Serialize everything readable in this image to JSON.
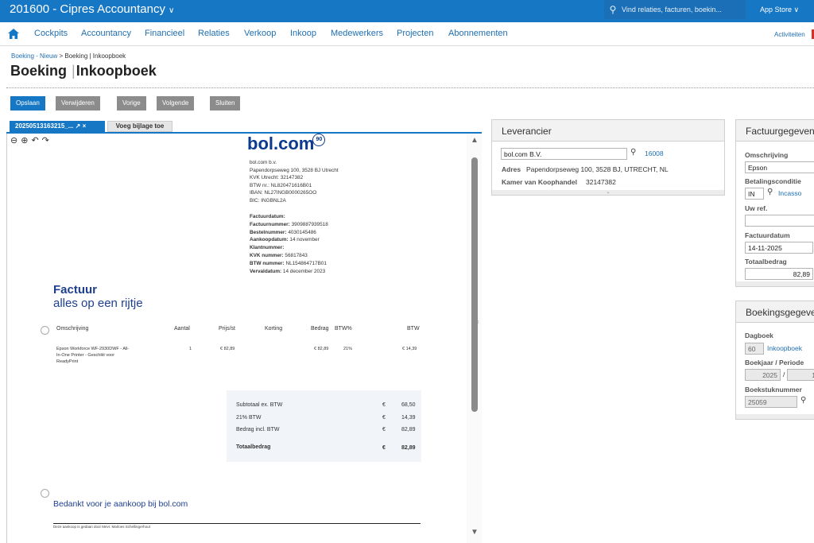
{
  "app": {
    "title": "201600 - Cipres Accountancy",
    "search_placeholder": "Vind relaties, facturen, boekin...",
    "app_store": "App Store"
  },
  "menu": {
    "items": [
      "Cockpits",
      "Accountancy",
      "Financieel",
      "Relaties",
      "Verkoop",
      "Inkoop",
      "Medewerkers",
      "Projecten",
      "Abonnementen"
    ],
    "activities": "Activiteiten"
  },
  "breadcrumb": {
    "link": "Boeking - Nieuw",
    "rest": " > Boeking | Inkoopboek"
  },
  "page": {
    "title_main": "Boeking",
    "title_sub": "Inkoopboek"
  },
  "toolbar": {
    "save": "Opslaan",
    "delete": "Verwijderen",
    "prev": "Vorige",
    "next": "Volgende",
    "close": "Sluiten"
  },
  "attachments": {
    "tab_label": "20250513163215_...",
    "add_label": "Voeg bijlage toe"
  },
  "invoice": {
    "logo": "bol.com",
    "logo_badge": "90",
    "address_lines": [
      "bol.com b.v.",
      "Papendorpseweg 100, 3528 BJ Utrecht",
      "KVK Utrecht: 32147382",
      "BTW nr.: NL820471616B01",
      "IBAN: NL27INGB0000265OO",
      "BIC: INGBNL2A"
    ],
    "meta": [
      {
        "k": "Factuurdatum:",
        "v": ""
      },
      {
        "k": "Factuurnummer:",
        "v": "3909887939518"
      },
      {
        "k": "Bestelnummer:",
        "v": "4030145486"
      },
      {
        "k": "Aankoopdatum:",
        "v": "14 november"
      },
      {
        "k": "Klantnummer:",
        "v": ""
      },
      {
        "k": "KVK nummer:",
        "v": "56817843"
      },
      {
        "k": "BTW nummer:",
        "v": "NL154864717B01"
      },
      {
        "k": "Vervaldatum:",
        "v": "14 december 2023"
      }
    ],
    "heading": "Factuur",
    "subheading": "alles op een rijtje",
    "columns": {
      "desc": "Omschrijving",
      "qty": "Aantal",
      "price": "Prijs/st",
      "discount": "Korting",
      "amount": "Bedrag",
      "vat_pct": "BTW%",
      "vat": "BTW"
    },
    "line": {
      "desc1": "Epson Workforce WF-2930DWF - All-",
      "desc2": "In-One Printer - Geschikt voor",
      "desc3": "ReadyPrint",
      "qty": "1",
      "price": "€ 82,89",
      "amount": "€ 82,89",
      "vat_pct": "21%",
      "vat": "€ 14,39"
    },
    "totals": {
      "sub_label": "Subtotaal ex. BTW",
      "sub_cur": "€",
      "sub_val": "68,50",
      "vat_label": "21% BTW",
      "vat_cur": "€",
      "vat_val": "14,39",
      "incl_label": "Bedrag incl. BTW",
      "incl_cur": "€",
      "incl_val": "82,89",
      "total_label": "Totaalbedrag",
      "total_cur": "€",
      "total_val": "82,89"
    },
    "thanks": "Bedankt voor je aankoop bij bol.com",
    "footer": "Deze aankoop is gedaan door Mevr. Marloes Schellingerhout"
  },
  "supplier": {
    "header": "Leverancier",
    "name": "bol.com B.V.",
    "number": "16008",
    "address_label": "Adres",
    "address": "Papendorpseweg 100, 3528 BJ, UTRECHT, NL",
    "kvk_label": "Kamer van Koophandel",
    "kvk": "32147382"
  },
  "invoice_details": {
    "header": "Factuurgegevens",
    "desc_label": "Omschrijving",
    "desc": "Epson",
    "terms_label": "Betalingsconditie",
    "terms_code": "IN",
    "terms_name": "Incasso",
    "ref_label": "Uw ref.",
    "ref": "",
    "date_label": "Factuurdatum",
    "date": "14-11-2025",
    "total_label": "Totaalbedrag",
    "total": "82,89"
  },
  "booking": {
    "header": "Boekingsgegevens",
    "journal_label": "Dagboek",
    "journal_code": "60",
    "journal_name": "Inkoopboek",
    "period_label": "Boekjaar / Periode",
    "year": "2025",
    "period": "1",
    "doc_label": "Boekstuknummer",
    "doc": "25059"
  }
}
